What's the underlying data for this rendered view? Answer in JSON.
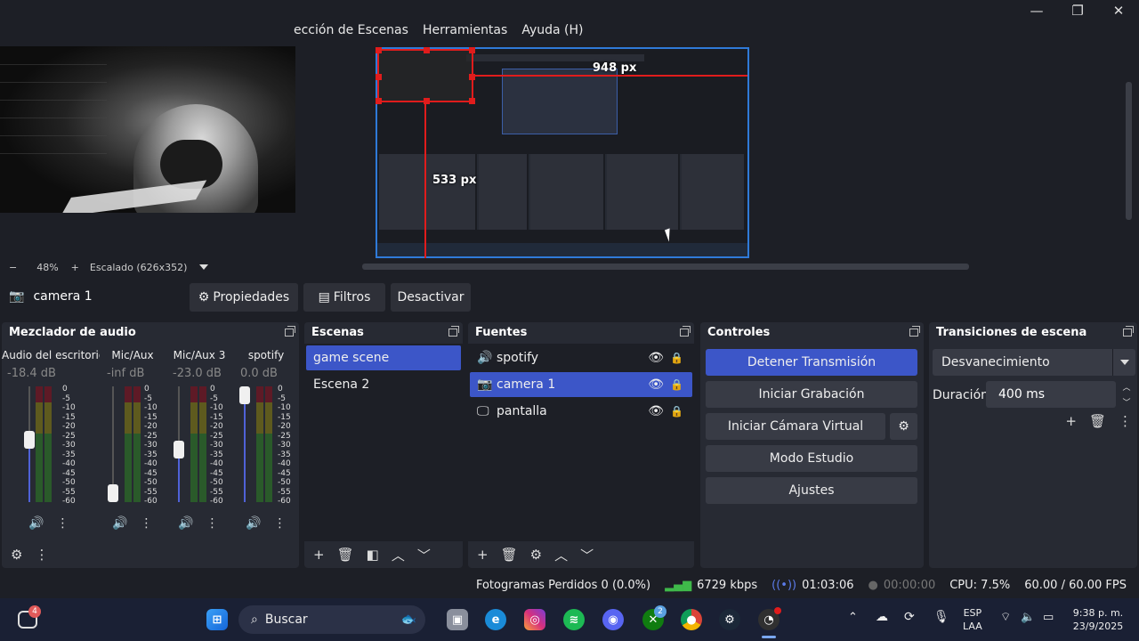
{
  "menubar": [
    "ección de Escenas",
    "Herramientas",
    "Ayuda (H)"
  ],
  "window_controls": {
    "minimize": "—",
    "maximize": "❐",
    "close": "✕"
  },
  "preview": {
    "measure_horizontal": "948 px",
    "measure_vertical": "533 px"
  },
  "zoom": {
    "minus": "−",
    "percent": "48%",
    "plus": "+",
    "scaling": "Escalado (626x352)"
  },
  "source_toolbar": {
    "source_name": "camera 1",
    "properties": "Propiedades",
    "filters": "Filtros",
    "deactivate": "Desactivar"
  },
  "mixer": {
    "title": "Mezclador de audio",
    "channels": [
      {
        "name": "Audio del escritorio",
        "db": "-18.4 dB",
        "fader_level": 0.55
      },
      {
        "name": "Mic/Aux",
        "db": "-inf dB",
        "fader_level": 0.0
      },
      {
        "name": "Mic/Aux 3",
        "db": "-23.0 dB",
        "fader_level": 0.45
      },
      {
        "name": "spotify",
        "db": "0.0 dB",
        "fader_level": 1.0
      }
    ],
    "scale": [
      "0",
      "-5",
      "-10",
      "-15",
      "-20",
      "-25",
      "-30",
      "-35",
      "-40",
      "-45",
      "-50",
      "-55",
      "-60"
    ]
  },
  "scenes": {
    "title": "Escenas",
    "items": [
      {
        "label": "game scene",
        "selected": true
      },
      {
        "label": "Escena 2",
        "selected": false
      }
    ]
  },
  "sources": {
    "title": "Fuentes",
    "items": [
      {
        "label": "spotify",
        "icon": "speaker-icon",
        "selected": false
      },
      {
        "label": "camera 1",
        "icon": "camera-icon",
        "selected": true
      },
      {
        "label": "pantalla",
        "icon": "monitor-icon",
        "selected": false
      }
    ]
  },
  "controls": {
    "title": "Controles",
    "stop_stream": "Detener Transmisión",
    "start_recording": "Iniciar Grabación",
    "start_virtual_cam": "Iniciar Cámara Virtual",
    "studio_mode": "Modo Estudio",
    "settings": "Ajustes"
  },
  "transitions": {
    "title": "Transiciones de escena",
    "selected": "Desvanecimiento",
    "duration_label": "Duración",
    "duration_value": "400 ms"
  },
  "status_bar": {
    "dropped_frames": "Fotogramas Perdidos 0 (0.0%)",
    "bitrate": "6729 kbps",
    "stream_time": "01:03:06",
    "record_time": "00:00:00",
    "cpu": "CPU: 7.5%",
    "fps": "60.00 / 60.00 FPS"
  },
  "taskbar": {
    "widgets_badge": "4",
    "search_placeholder": "Buscar",
    "xbox_badge": "2",
    "lang_top": "ESP",
    "lang_bottom": "LAA",
    "time": "9:38 p. m.",
    "date": "23/9/2025"
  },
  "colors": {
    "accent": "#3c56c8",
    "record_red": "#e01c1c",
    "selection_blue": "#2f7ad8"
  }
}
